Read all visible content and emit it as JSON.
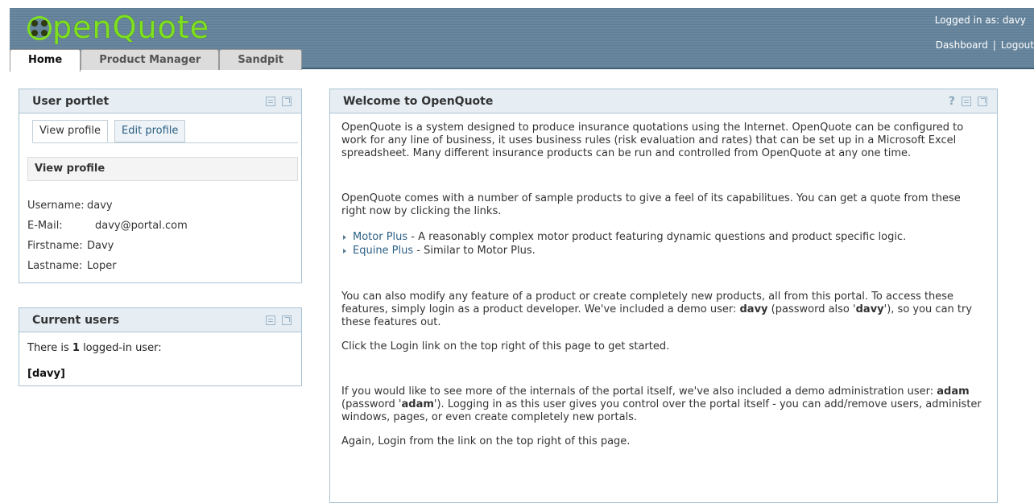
{
  "app": {
    "logo_text": "penQuote",
    "logged_in_text": "Logged in as: davy",
    "links": [
      "Dashboard",
      "Logout"
    ],
    "separator": "|"
  },
  "tabs": [
    {
      "label": "Home",
      "active": true
    },
    {
      "label": "Product Manager",
      "active": false
    },
    {
      "label": "Sandpit",
      "active": false
    }
  ],
  "user_portlet": {
    "title": "User portlet",
    "subtabs": [
      "View profile",
      "Edit profile"
    ],
    "section_title": "View profile",
    "fields": [
      {
        "label": "Username:",
        "value": "davy"
      },
      {
        "label": "E-Mail:",
        "value": "davy@portal.com"
      },
      {
        "label": "Firstname:",
        "value": "Davy"
      },
      {
        "label": "Lastname:",
        "value": "Loper"
      }
    ]
  },
  "current_users": {
    "title": "Current users",
    "text_before": "There is ",
    "count": "1",
    "text_after": " logged-in user:",
    "user": "[davy]"
  },
  "welcome": {
    "title": "Welcome to OpenQuote",
    "help_icon": "?",
    "p1": "OpenQuote is a system designed to produce insurance quotations using the Internet. OpenQuote can be configured to work for any line of business, it uses business rules (risk evaluation and rates) that can be set up in a Microsoft Excel spreadsheet. Many different insurance products can be run and controlled from OpenQuote at any one time.",
    "p2": "OpenQuote comes with a number of sample products to give a feel of its capabilitues. You can get a quote from these right now by clicking the links.",
    "links": [
      {
        "label": "Motor Plus",
        "desc": " - A reasonably complex motor product featuring dynamic questions and product specific logic."
      },
      {
        "label": "Equine Plus",
        "desc": " - Similar to Motor Plus."
      }
    ],
    "p3_a": "You can also modify any feature of a product or create completely new products, all from this portal. To access these features, simply login as a product developer. We've included a demo user: ",
    "p3_user": "davy",
    "p3_b": " (password also '",
    "p3_pass": "davy",
    "p3_c": "'), so you can try these features out.",
    "p4": "Click the Login link on the top right of this page to get started.",
    "p5_a": "If you would like to see more of the internals of the portal itself, we've also included a demo administration user: ",
    "p5_user": "adam",
    "p5_b": " (password '",
    "p5_pass": "adam",
    "p5_c": "'). Logging in as this user gives you control over the portal itself - you can add/remove users, administer windows, pages, or even create completely new portals.",
    "p6": "Again, Login from the link on the top right of this page."
  },
  "icons": [
    "minimize-icon",
    "maximize-icon",
    "help-icon",
    "logo-icon",
    "bullet-arrow-icon"
  ],
  "colors": {
    "logo": "#7ee01e",
    "header": "#6c8aa1",
    "link": "#2b5f84",
    "portlet_header": "#e6eef4"
  }
}
